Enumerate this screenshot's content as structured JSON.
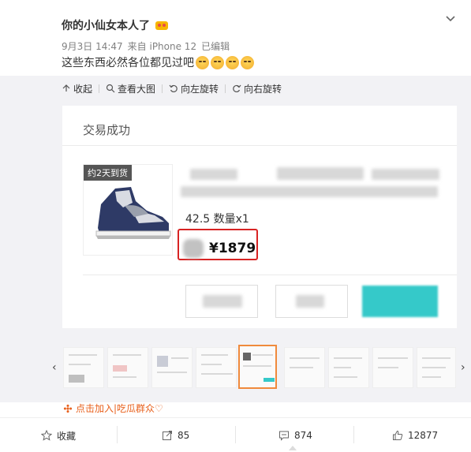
{
  "post": {
    "username": "你的小仙女本人了",
    "date": "9月3日 14:47",
    "source": "来自 iPhone 12",
    "edited": "已编辑",
    "text": "这些东西必然各位都见过吧"
  },
  "toolbar": {
    "collapse": "收起",
    "view_large": "查看大图",
    "rotate_left": "向左旋转",
    "rotate_right": "向右旋转"
  },
  "screenshot": {
    "title": "交易成功",
    "shipping_tag": "约2天到货",
    "spec": "42.5 数量x1",
    "price": "¥1879"
  },
  "promo": {
    "text": "点击加入|吃瓜群众♡"
  },
  "footer": {
    "favorite_label": "收藏",
    "repost_count": "85",
    "comment_count": "874",
    "like_count": "12877"
  },
  "colors": {
    "price_border": "#d82323",
    "active_thumb_border": "#f08a3c",
    "promo_text": "#e8601c",
    "teal_button": "#35c9c9"
  }
}
